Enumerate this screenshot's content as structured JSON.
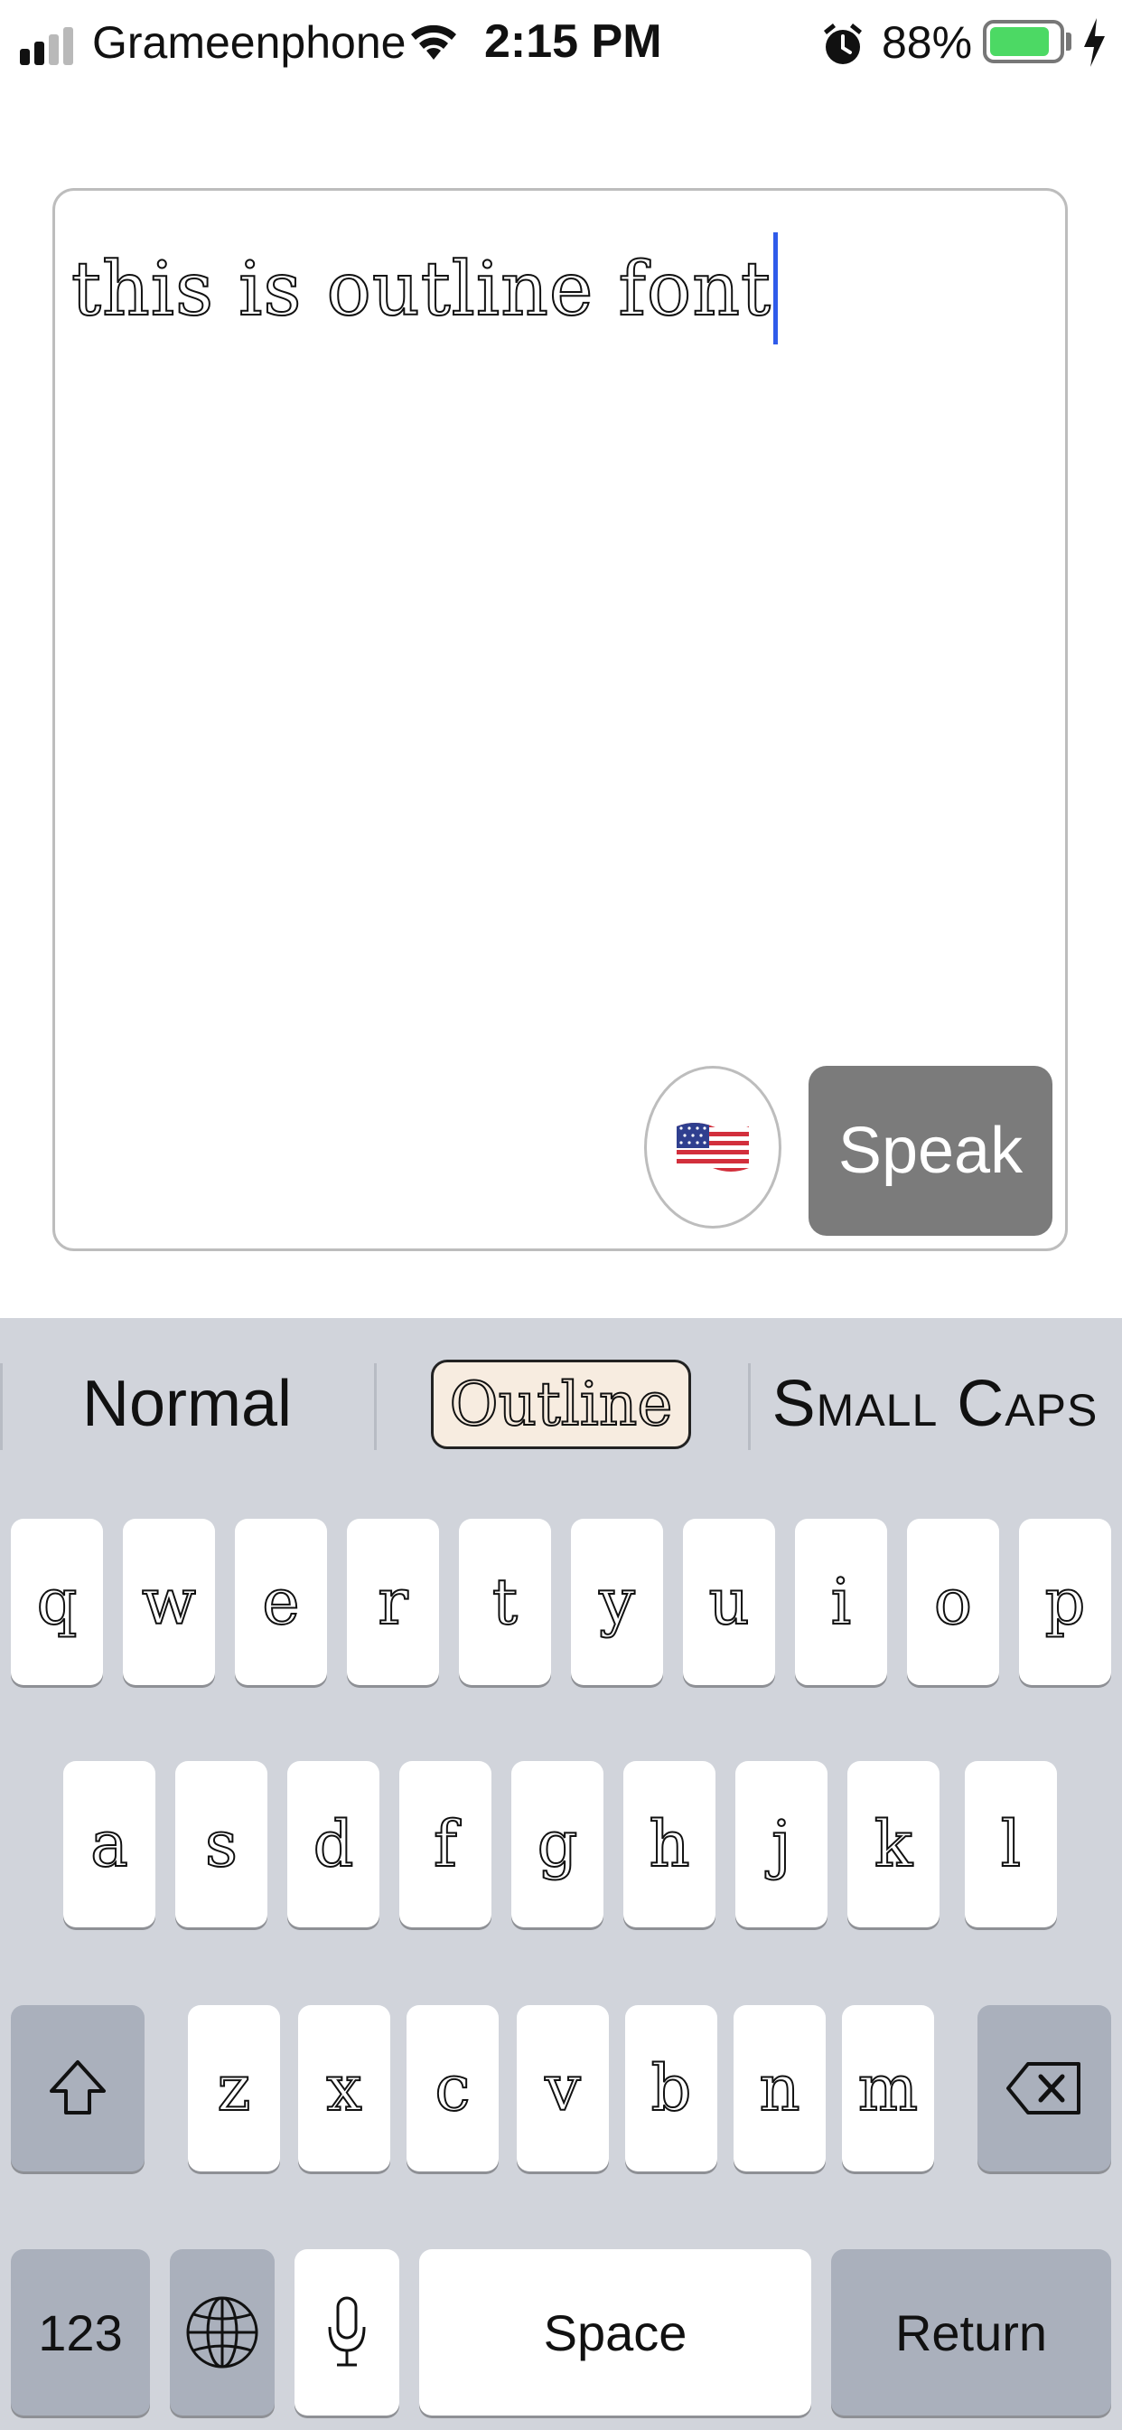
{
  "status_bar": {
    "carrier": "Grameenphone",
    "time": "2:15 PM",
    "battery_percent": "88%",
    "battery_level": 0.88,
    "icons": [
      "signal-icon",
      "wifi-icon",
      "alarm-icon",
      "battery-icon",
      "charging-bolt-icon"
    ]
  },
  "editor": {
    "text": "this is outline font",
    "flag_icon": "us-flag-icon",
    "flag_glyph": "🇺🇸",
    "speak_label": "Speak",
    "speak_color": "#7b7b7b",
    "caret_color": "#2f5bea"
  },
  "keyboard": {
    "suggestions": [
      "Normal",
      "Outline",
      "Small Caps"
    ],
    "selected_suggestion": "Outline",
    "rows": [
      [
        "q",
        "w",
        "e",
        "r",
        "t",
        "y",
        "u",
        "i",
        "o",
        "p"
      ],
      [
        "a",
        "s",
        "d",
        "f",
        "g",
        "h",
        "j",
        "k",
        "l"
      ],
      [
        "z",
        "x",
        "c",
        "v",
        "b",
        "n",
        "m"
      ]
    ],
    "numbers_label": "123",
    "space_label": "Space",
    "return_label": "Return",
    "function_icons": [
      "shift-icon",
      "delete-icon",
      "globe-icon",
      "microphone-icon"
    ],
    "background": "#d1d4db",
    "function_key_color": "#aab0bc"
  }
}
